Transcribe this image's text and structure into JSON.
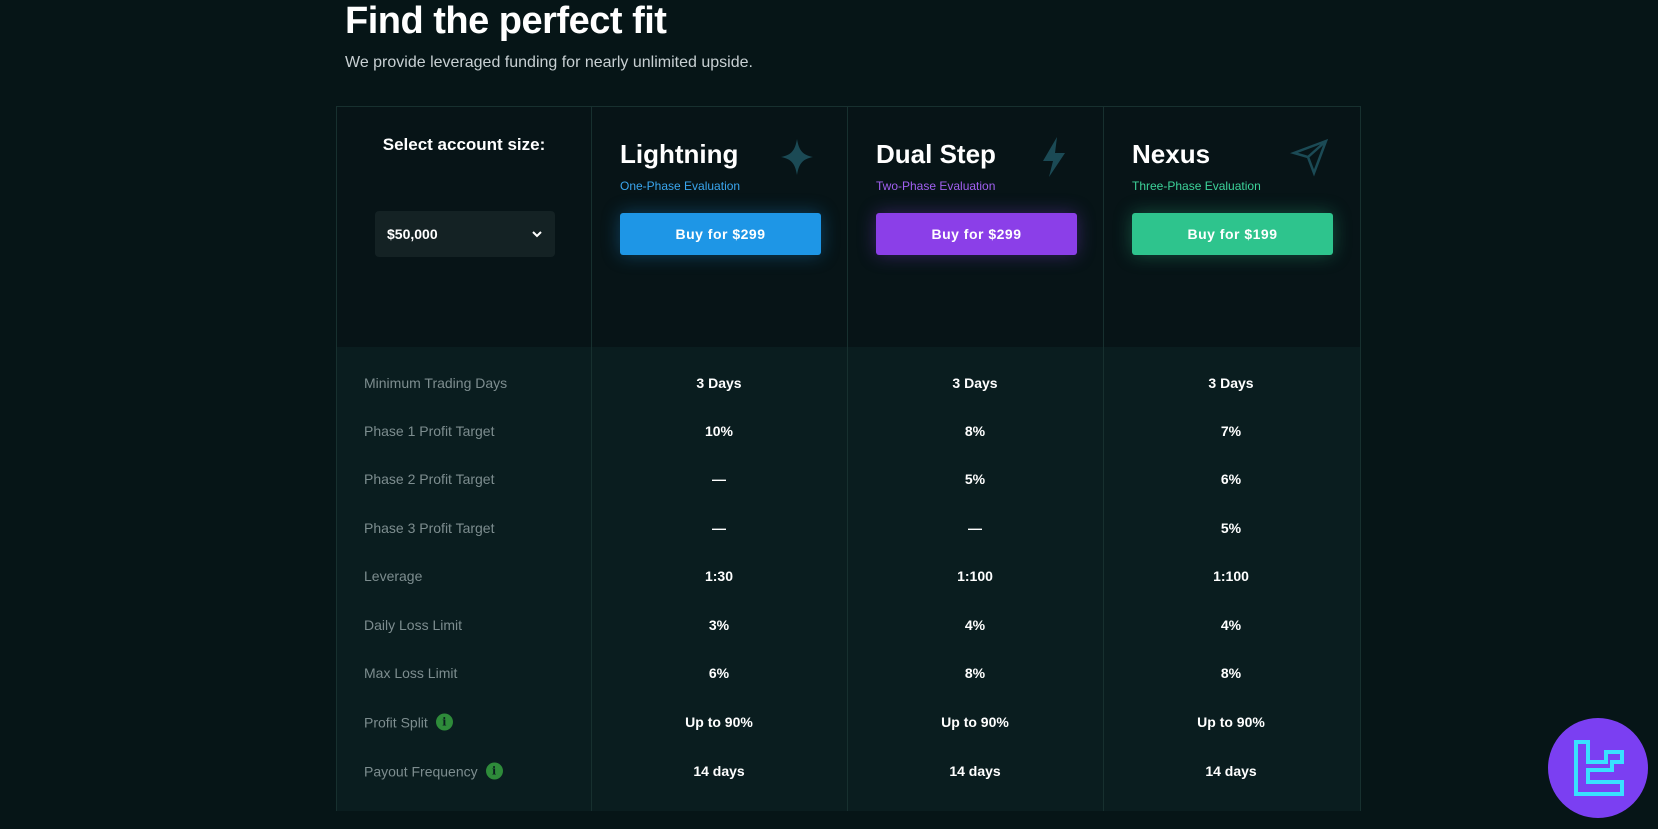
{
  "hero": {
    "title": "Find the perfect fit",
    "subtitle": "We provide leveraged funding for nearly unlimited upside."
  },
  "selector": {
    "label": "Select account size:",
    "value": "$50,000",
    "chevron_icon": "chevron-down-icon"
  },
  "plans": [
    {
      "name": "Lightning",
      "subtitle": "One-Phase Evaluation",
      "button": "Buy for $299",
      "accent": "#1e96e6",
      "sub_color": "#3aa6ee",
      "icon": "sparkle-icon"
    },
    {
      "name": "Dual Step",
      "subtitle": "Two-Phase Evaluation",
      "button": "Buy for $299",
      "accent": "#8b3fe8",
      "sub_color": "#a160f0",
      "icon": "lightning-icon"
    },
    {
      "name": "Nexus",
      "subtitle": "Three-Phase Evaluation",
      "button": "Buy for $199",
      "accent": "#2ec48d",
      "sub_color": "#3dd39a",
      "icon": "paper-plane-icon"
    }
  ],
  "rows": [
    {
      "label": "Minimum Trading Days",
      "values": [
        "3 Days",
        "3 Days",
        "3 Days"
      ]
    },
    {
      "label": "Phase 1 Profit Target",
      "values": [
        "10%",
        "8%",
        "7%"
      ]
    },
    {
      "label": "Phase 2 Profit Target",
      "values": [
        "—",
        "5%",
        "6%"
      ]
    },
    {
      "label": "Phase 3 Profit Target",
      "values": [
        "—",
        "—",
        "5%"
      ]
    },
    {
      "label": "Leverage",
      "values": [
        "1:30",
        "1:100",
        "1:100"
      ]
    },
    {
      "label": "Daily Loss Limit",
      "values": [
        "3%",
        "4%",
        "4%"
      ]
    },
    {
      "label": "Max Loss Limit",
      "values": [
        "6%",
        "8%",
        "8%"
      ]
    },
    {
      "label": "Profit Split",
      "values": [
        "Up to 90%",
        "Up to 90%",
        "Up to 90%"
      ],
      "info": true
    },
    {
      "label": "Payout Frequency",
      "values": [
        "14 days",
        "14 days",
        "14 days"
      ],
      "info": true
    }
  ],
  "info_icon_glyph": "i"
}
